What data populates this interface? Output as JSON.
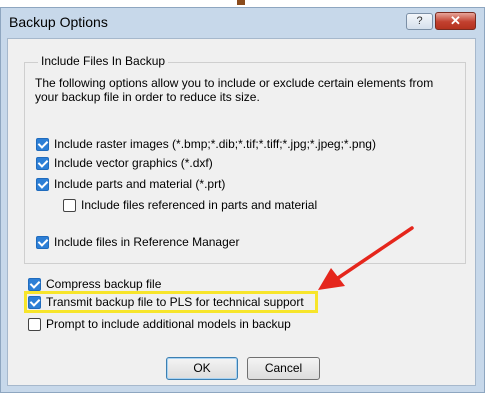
{
  "window": {
    "title": "Backup Options",
    "help_glyph": "?",
    "close_glyph": "✕"
  },
  "group": {
    "title": "Include Files In Backup",
    "description": "The following options allow you to include or exclude certain elements from your backup file in order to reduce its size."
  },
  "group_options": [
    {
      "label": "Include raster images (*.bmp;*.dib;*.tif;*.tiff;*.jpg;*.jpeg;*.png)",
      "checked": true
    },
    {
      "label": "Include vector graphics (*.dxf)",
      "checked": true
    },
    {
      "label": "Include parts and material (*.prt)",
      "checked": true
    },
    {
      "label": "Include files referenced in parts and material",
      "checked": false
    },
    {
      "label": "Include files in Reference Manager",
      "checked": true
    }
  ],
  "options": [
    {
      "label": "Compress backup file",
      "checked": true
    },
    {
      "label": "Transmit backup file to PLS for technical support",
      "checked": true
    },
    {
      "label": "Prompt to include additional models in backup",
      "checked": false
    }
  ],
  "buttons": {
    "ok": "OK",
    "cancel": "Cancel"
  },
  "colors": {
    "highlight": "#f7e52b",
    "arrow": "#e5261c",
    "checkbox": "#2d7fd6"
  }
}
